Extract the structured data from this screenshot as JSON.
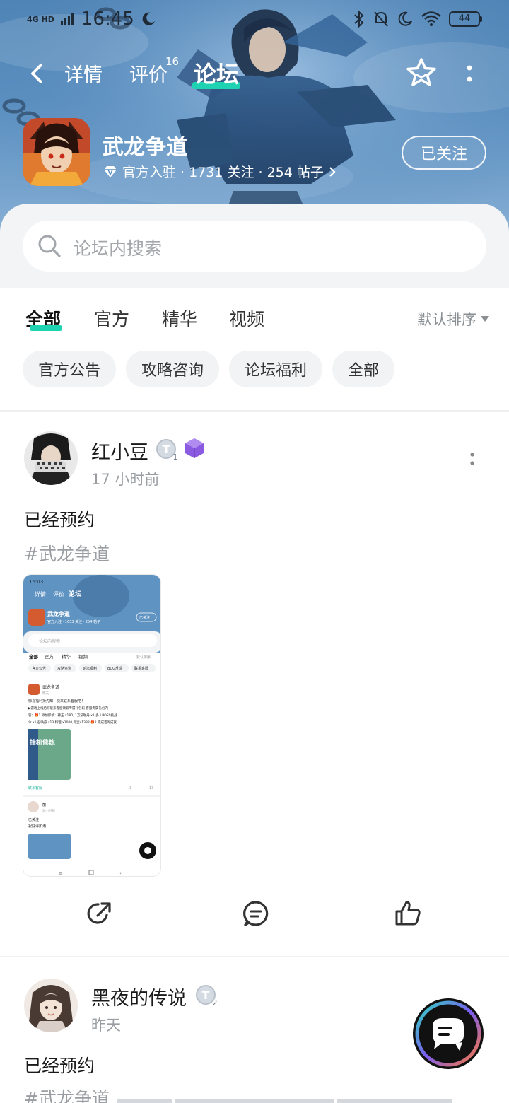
{
  "status": {
    "network": "4G HD",
    "time": "16:45",
    "battery": "44"
  },
  "nav": {
    "tabs": [
      {
        "label": "详情"
      },
      {
        "label": "评价",
        "badge": "16"
      },
      {
        "label": "论坛"
      }
    ]
  },
  "game": {
    "name": "武龙争道",
    "meta": "官方入驻 · 1731 关注 · 254 帖子",
    "follow_label": "已关注"
  },
  "search": {
    "placeholder": "论坛内搜索"
  },
  "categories": {
    "tabs": [
      "全部",
      "官方",
      "精华",
      "视频"
    ],
    "sort_label": "默认排序",
    "chips": [
      "官方公告",
      "攻略咨询",
      "论坛福利",
      "全部"
    ]
  },
  "posts": [
    {
      "username": "红小豆",
      "time": "17 小时前",
      "title": "已经预约",
      "tag": "#武龙争道",
      "level": "1"
    },
    {
      "username": "黑夜的传说",
      "time": "昨天",
      "title": "已经预约",
      "tag": "#武龙争道",
      "level": "2"
    }
  ],
  "thumbnail": {
    "time": "16:03",
    "tabs": [
      "详情",
      "评价",
      "论坛"
    ],
    "game_name": "武龙争道",
    "game_meta": "官方入驻 · 1633 关注 · 254 帖子",
    "follow": "已关注",
    "search": "论坛内搜索",
    "cats": [
      "全部",
      "官方",
      "精华",
      "视频"
    ],
    "sort": "默认排序",
    "chips": [
      "官方公告",
      "攻略咨询",
      "论坛福利",
      "BUG反馈",
      "联系客服"
    ],
    "post_author": "武龙争道",
    "post_time": "昨天",
    "post_line1": "惊喜福利抢先知！快来联系客服吧！",
    "post_line2": "▶游戏上线后可联系客服领取专属礼包码 客服专属礼包内",
    "post_line3": "容：🎁1.添加即领：神玉 x180, 1万法咖丹 x1,多人BOSS挑战",
    "post_line4": "令 x1,召唤券 x13,料理 x1000,元宝x1388 🎁2.完成咨询成就...",
    "post_label": "挂机修炼",
    "post_footer": "联系客服",
    "post_comments": "3",
    "post_likes": "13",
    "post2_name": "丽",
    "post2_time": "3 小时前",
    "post2_line1": "已关注",
    "post2_line2": "祝好评如潮"
  }
}
